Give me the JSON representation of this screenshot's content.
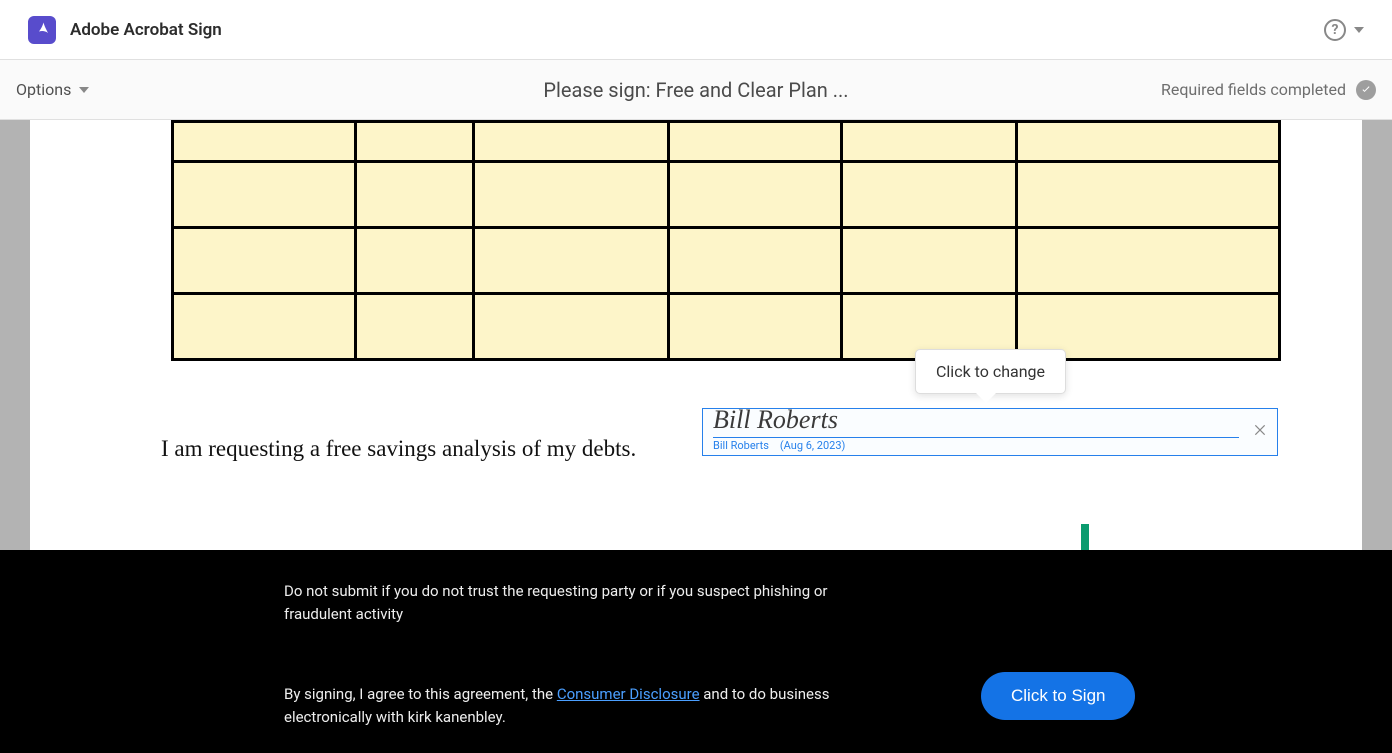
{
  "header": {
    "app_name": "Adobe Acrobat Sign"
  },
  "subheader": {
    "options_label": "Options",
    "document_title": "Please sign: Free and Clear Plan ...",
    "required_status": "Required fields completed"
  },
  "document": {
    "request_text": "I am requesting a free savings analysis of my debts.",
    "signature": {
      "signed_name": "Bill Roberts",
      "meta_name": "Bill Roberts",
      "meta_date": "(Aug 6, 2023)"
    },
    "tooltip": "Click to change"
  },
  "footer": {
    "warning": "Do not submit if you do not trust the requesting party or if you suspect phishing or fraudulent activity",
    "agree_prefix": "By signing, I agree to this agreement, the ",
    "consumer_link": "Consumer Disclosure",
    "agree_suffix": " and to do business electronically with kirk kanenbley.",
    "sign_button": "Click to Sign"
  },
  "colors": {
    "brand": "#584ccc",
    "accent": "#1473e6",
    "arrow": "#0a9b6e",
    "table_fill": "#fdf5c9"
  }
}
